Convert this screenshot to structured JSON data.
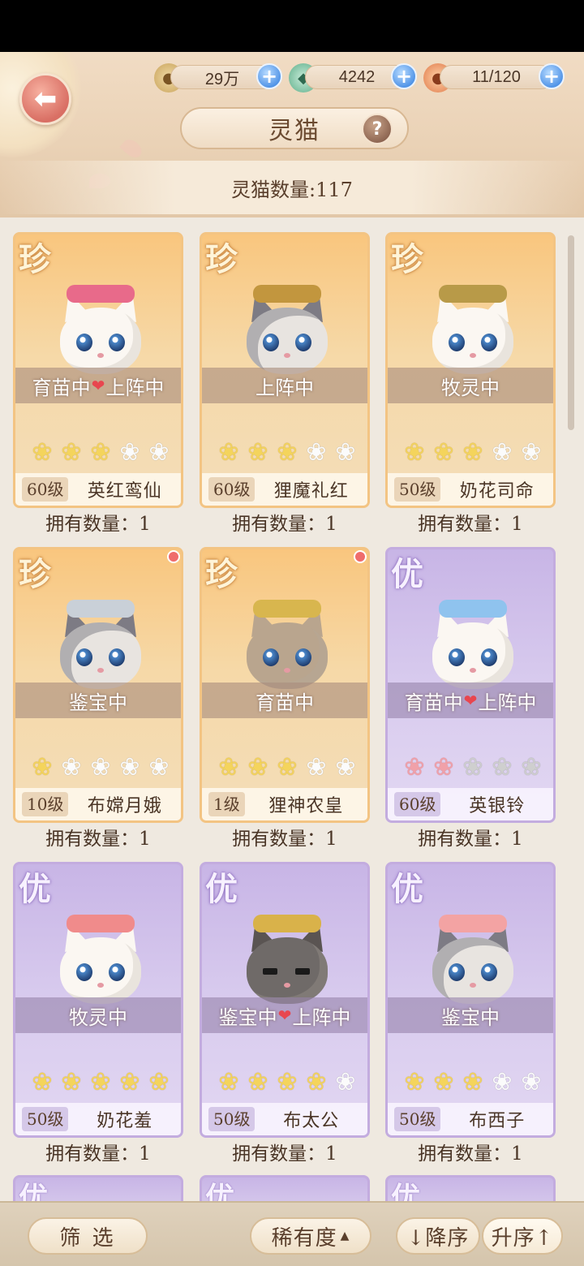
{
  "header": {
    "title": "灵猫",
    "resources": [
      {
        "icon": "paw-coin-icon",
        "value": "29万"
      },
      {
        "icon": "jade-icon",
        "value": "4242"
      },
      {
        "icon": "food-bowl-icon",
        "value": "11/120"
      }
    ],
    "cat_count_label": "灵猫数量:117"
  },
  "cards": [
    {
      "rarity": "珍",
      "status": "育苗中",
      "status2": "上阵中",
      "level": "60级",
      "name": "英红鸾仙",
      "owned": "拥有数量：1",
      "stars_filled": 3,
      "stars_total": 5,
      "new_dot": false
    },
    {
      "rarity": "珍",
      "status": "上阵中",
      "status2": "",
      "level": "60级",
      "name": "狸魔礼红",
      "owned": "拥有数量：1",
      "stars_filled": 3,
      "stars_total": 5,
      "new_dot": false
    },
    {
      "rarity": "珍",
      "status": "牧灵中",
      "status2": "",
      "level": "50级",
      "name": "奶花司命",
      "owned": "拥有数量：1",
      "stars_filled": 3,
      "stars_total": 5,
      "new_dot": false
    },
    {
      "rarity": "珍",
      "status": "鉴宝中",
      "status2": "",
      "level": "10级",
      "name": "布嫦月娥",
      "owned": "拥有数量：1",
      "stars_filled": 1,
      "stars_total": 5,
      "new_dot": true
    },
    {
      "rarity": "珍",
      "status": "育苗中",
      "status2": "",
      "level": "1级",
      "name": "狸神农皇",
      "owned": "拥有数量：1",
      "stars_filled": 3,
      "stars_total": 5,
      "new_dot": true
    },
    {
      "rarity": "优",
      "status": "育苗中",
      "status2": "上阵中",
      "level": "60级",
      "name": "英银铃",
      "owned": "拥有数量：1",
      "stars_filled": 2,
      "stars_total": 5,
      "new_dot": false
    },
    {
      "rarity": "优",
      "status": "牧灵中",
      "status2": "",
      "level": "50级",
      "name": "奶花羞",
      "owned": "拥有数量：1",
      "stars_filled": 5,
      "stars_total": 5,
      "new_dot": false
    },
    {
      "rarity": "优",
      "status": "鉴宝中",
      "status2": "上阵中",
      "level": "50级",
      "name": "布太公",
      "owned": "拥有数量：1",
      "stars_filled": 4,
      "stars_total": 5,
      "new_dot": false
    },
    {
      "rarity": "优",
      "status": "鉴宝中",
      "status2": "",
      "level": "50级",
      "name": "布西子",
      "owned": "拥有数量：1",
      "stars_filled": 3,
      "stars_total": 5,
      "new_dot": false
    }
  ],
  "partial_row_badges": [
    "优",
    "优",
    "优"
  ],
  "bottom": {
    "filter_label": "筛 选",
    "sort_label": "稀有度",
    "desc_label": "↓降序",
    "asc_label": "升序↑"
  },
  "colors": {
    "rare_frame": "#f3c483",
    "excellent_frame": "#c3acdf",
    "star_gold": "#f4d45c",
    "plus_blue": "#4d91e6"
  }
}
